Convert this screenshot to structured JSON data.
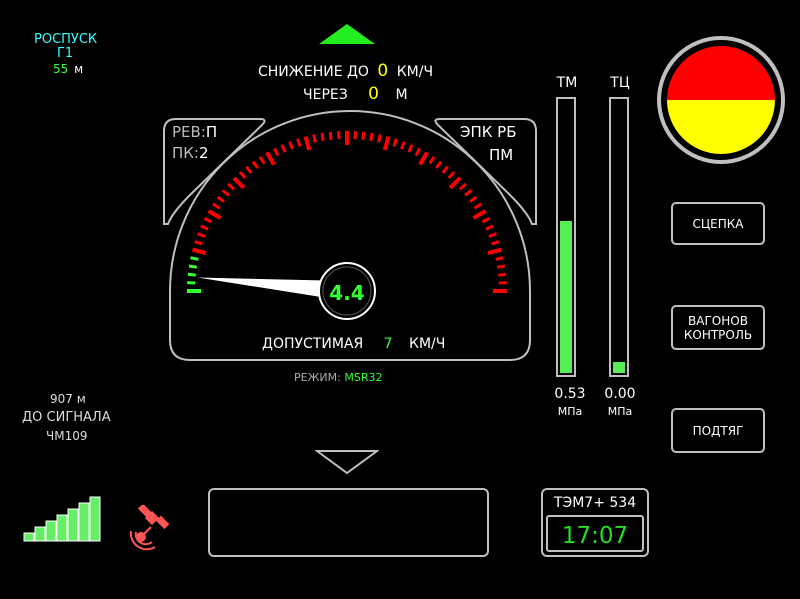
{
  "top_left": {
    "mode": "РОСПУСК",
    "track": "Г1",
    "distance_value": "55",
    "distance_unit": "м"
  },
  "header": {
    "descent_label": "СНИЖЕНИЕ ДО",
    "descent_value": "0",
    "descent_unit": "КМ/Ч",
    "after_label": "ЧЕРЕЗ",
    "after_value": "0",
    "after_unit": "М"
  },
  "left_panel": {
    "rev_label": "РЕВ:",
    "rev_value": "П",
    "pk_label": "ПК:",
    "pk_value": "2"
  },
  "right_panel": {
    "line1": "ЭПК РБ",
    "line2": "ПМ"
  },
  "gauge": {
    "speed": "4.4",
    "speed_fraction": 0.0,
    "allowed_label": "ДОПУСТИМАЯ",
    "allowed_value": "7",
    "allowed_unit": "КМ/Ч"
  },
  "mode": {
    "label": "РЕЖИМ:",
    "value": "MSR32"
  },
  "signal": {
    "distance": "907 м",
    "label": "ДО СИГНАЛА",
    "name": "ЧМ109"
  },
  "pressure": {
    "tm": {
      "label": "ТМ",
      "value": "0.53",
      "unit": "МПа",
      "fill_fraction": 0.55
    },
    "tc": {
      "label": "ТЦ",
      "value": "0.00",
      "unit": "МПа",
      "fill_fraction": 0.04
    }
  },
  "buttons": {
    "coupling": "СЦЕПКА",
    "wagons_line1": "ВАГОНОВ",
    "wagons_line2": "КОНТРОЛЬ",
    "pull": "ПОДТЯГ"
  },
  "loco": {
    "name": "ТЭМ7+ 534",
    "time": "17:07"
  },
  "signal_strength": {
    "bars": 7,
    "active": 7
  },
  "colors": {
    "green": "#33ff33",
    "red": "#ff0000",
    "yellow": "#ffff00",
    "cyan": "#33ffff",
    "border": "#bfbfbf"
  }
}
